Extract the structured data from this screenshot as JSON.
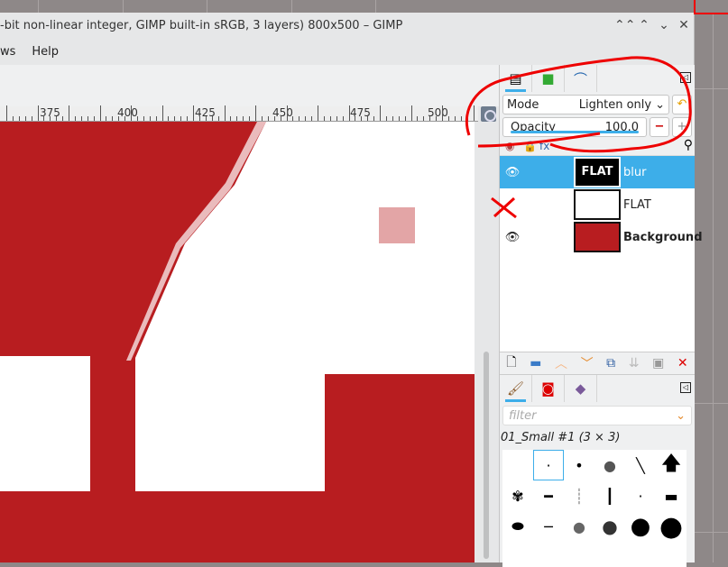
{
  "window": {
    "title": "-bit non-linear integer, GIMP built-in sRGB, 3 layers) 800x500 – GIMP",
    "controls": [
      "⌃⌃",
      "⌃",
      "⌄",
      "✕"
    ]
  },
  "menu": [
    "ws",
    "Help"
  ],
  "ruler": {
    "labels": [
      "375",
      "400",
      "425",
      "450",
      "475",
      "500"
    ]
  },
  "layers_panel": {
    "mode_label": "Mode",
    "mode_value": "Lighten only",
    "opacity_label": "Opacity",
    "opacity_value": "100.0",
    "opacity_fraction": 1.0,
    "layers": [
      {
        "name": "blur",
        "visible": true,
        "selected": true,
        "thumb_text": "FLAT"
      },
      {
        "name": "FLAT",
        "visible": false,
        "selected": false
      },
      {
        "name": "Background",
        "visible": true,
        "selected": false
      }
    ]
  },
  "brushes_panel": {
    "filter_placeholder": "filter",
    "brush_name": "01_Small #1 (3 × 3)"
  },
  "colors": {
    "canvas_red": "#b81d20",
    "accent": "#3daee9",
    "annotation": "#ee0000"
  }
}
